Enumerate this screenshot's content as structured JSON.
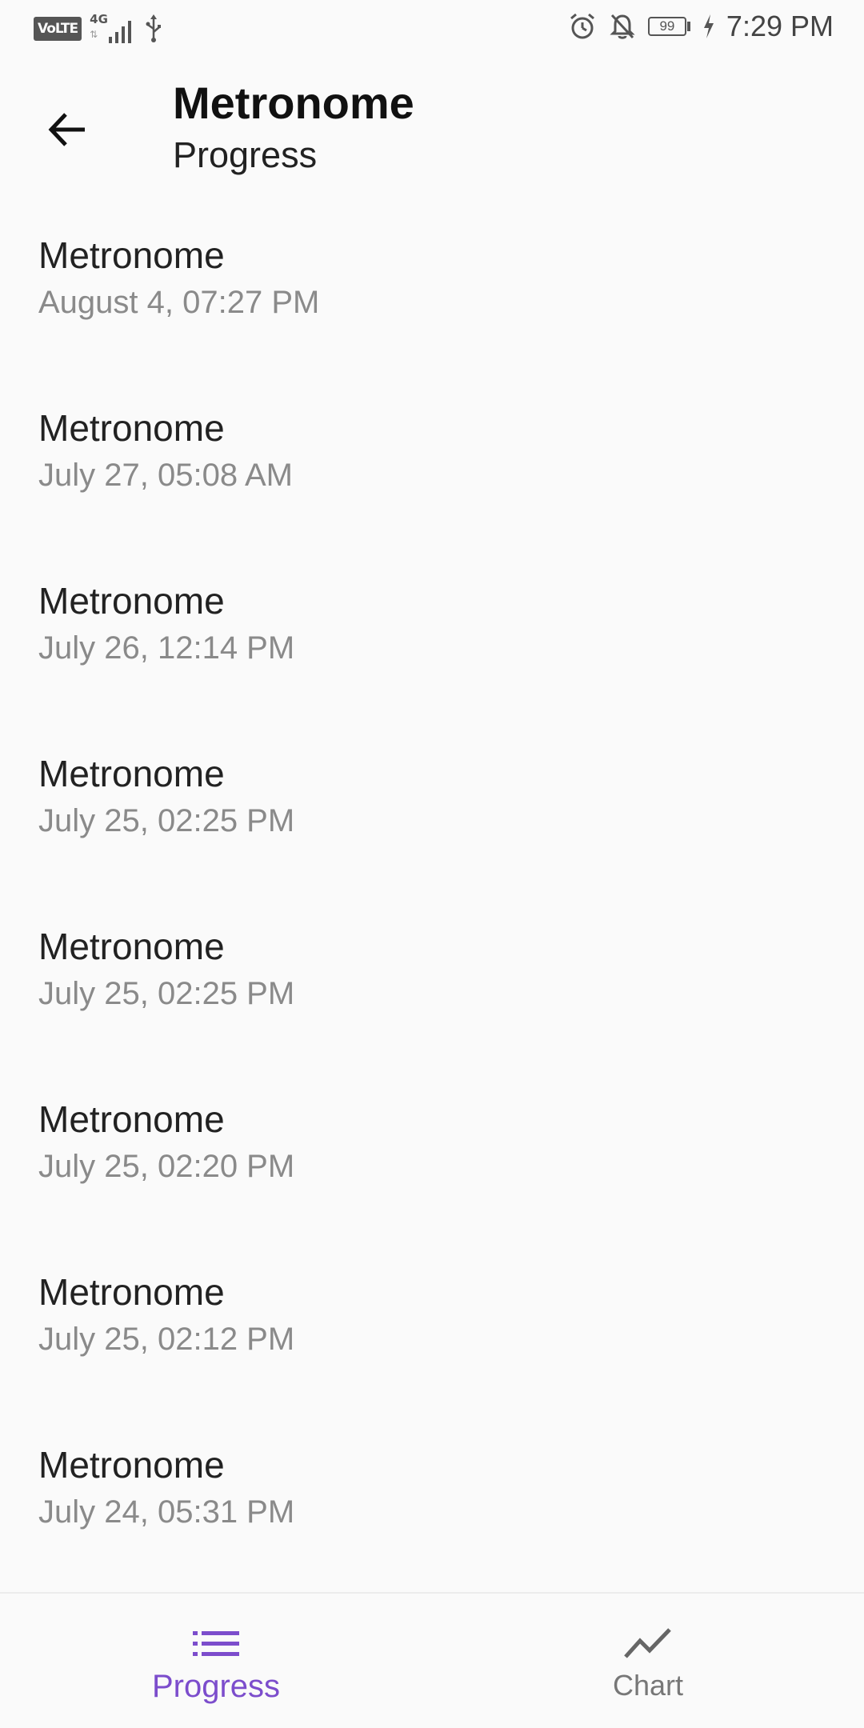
{
  "status_bar": {
    "volte": "VoLTE",
    "network": "4G",
    "battery": "99",
    "time": "7:29 PM"
  },
  "app_bar": {
    "title": "Metronome",
    "subtitle": "Progress"
  },
  "list": {
    "items": [
      {
        "title": "Metronome",
        "date": "August 4, 07:27 PM"
      },
      {
        "title": "Metronome",
        "date": "July 27, 05:08 AM"
      },
      {
        "title": "Metronome",
        "date": "July 26, 12:14 PM"
      },
      {
        "title": "Metronome",
        "date": "July 25, 02:25 PM"
      },
      {
        "title": "Metronome",
        "date": "July 25, 02:25 PM"
      },
      {
        "title": "Metronome",
        "date": "July 25, 02:20 PM"
      },
      {
        "title": "Metronome",
        "date": "July 25, 02:12 PM"
      },
      {
        "title": "Metronome",
        "date": "July 24, 05:31 PM"
      }
    ]
  },
  "bottom_nav": {
    "progress": {
      "label": "Progress",
      "icon": "list-icon",
      "active": true
    },
    "chart": {
      "label": "Chart",
      "icon": "trending-line-icon",
      "active": false
    }
  },
  "colors": {
    "accent": "#7c4dcc",
    "background": "#fafafa",
    "primary_text": "#222222",
    "secondary_text": "#8a8a8a"
  }
}
